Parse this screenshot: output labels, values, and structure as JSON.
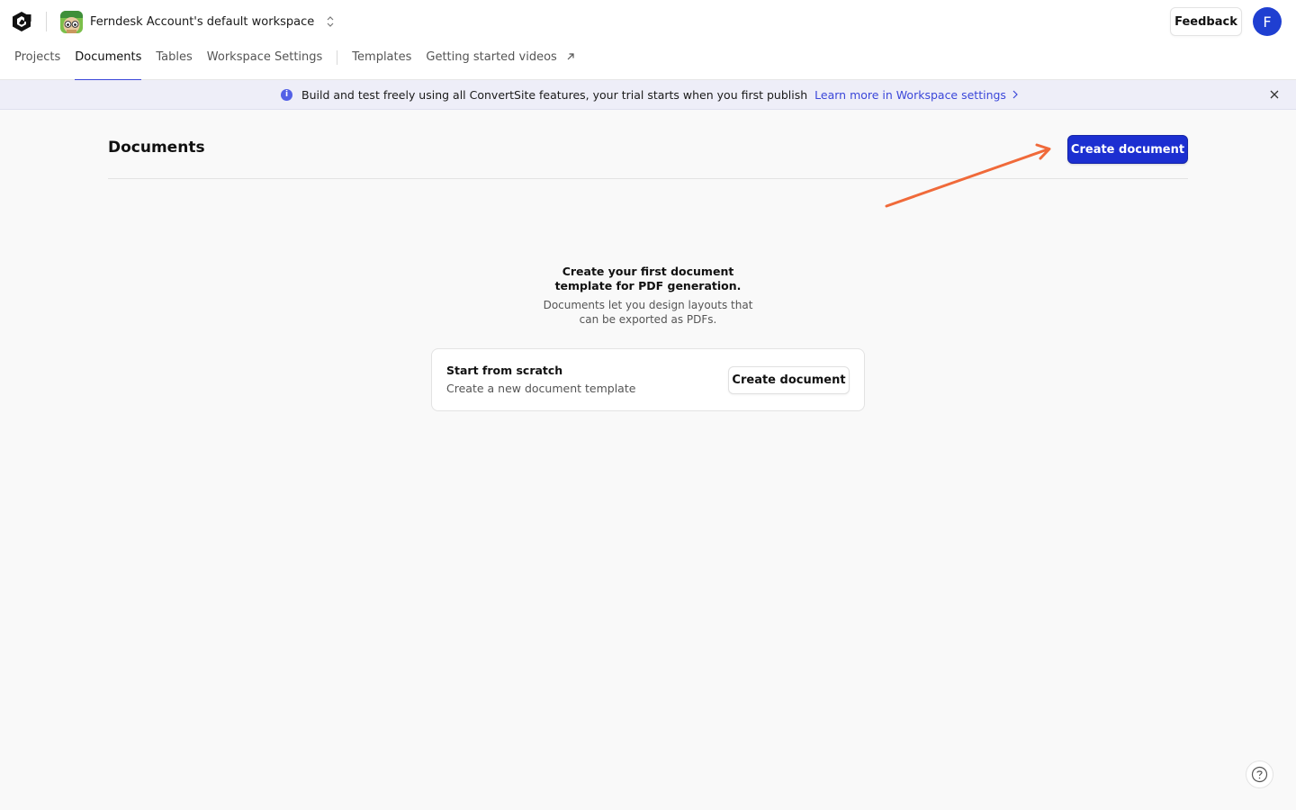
{
  "app": {
    "workspace_name": "Ferndesk Account's default workspace",
    "logo_icon": "app-logo-icon",
    "workspace_avatar_icon": "workspace-avatar-icon"
  },
  "header": {
    "feedback_label": "Feedback",
    "user_initial": "F",
    "accent_color": "#1f3fd1"
  },
  "nav": {
    "items": [
      {
        "label": "Projects"
      },
      {
        "label": "Documents",
        "active": true
      },
      {
        "label": "Tables"
      },
      {
        "label": "Workspace Settings"
      },
      {
        "label": "Templates"
      },
      {
        "label": "Getting started videos",
        "icon": "external-link-icon"
      }
    ]
  },
  "banner": {
    "text": "Build and test freely using all ConvertSite features, your trial starts when you first publish",
    "link_label": "Learn more in Workspace settings",
    "info_icon": "i",
    "background_color": "#eeeef8",
    "link_color": "#3b47d9"
  },
  "main": {
    "title": "Documents",
    "create_button_label": "Create document",
    "primary_color": "#1c2fd1",
    "arrow_color": "#f06a3a"
  },
  "empty_state": {
    "title": "Create your first document template for PDF generation.",
    "description": "Documents let you design layouts that can be exported as PDFs.",
    "card": {
      "title": "Start from scratch",
      "subtitle": "Create a new document template",
      "button_label": "Create document"
    }
  },
  "help": {
    "icon": "help-icon"
  }
}
